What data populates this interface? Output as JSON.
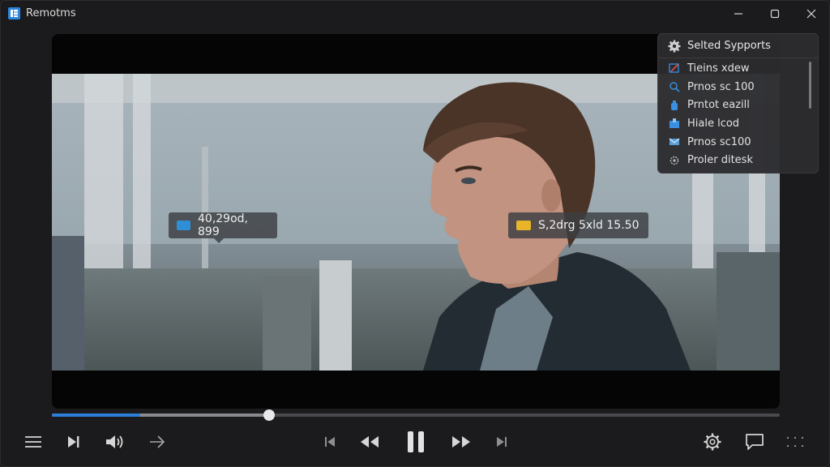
{
  "window": {
    "title": "Remotms"
  },
  "overlays": {
    "left_badge": "40,29od, 899",
    "right_badge": "S,2drg 5xld 15.50"
  },
  "panel": {
    "header": "Selted Sypports",
    "items": [
      {
        "label": "Tieins xdew",
        "icon": "pen-icon"
      },
      {
        "label": "Prnos sc 100",
        "icon": "search-icon"
      },
      {
        "label": "Prntot eazill",
        "icon": "bottle-icon"
      },
      {
        "label": "Hiale lcod",
        "icon": "upload-box-icon"
      },
      {
        "label": "Prnos sc100",
        "icon": "mail-icon"
      },
      {
        "label": "Proler ditesk",
        "icon": "gear-outline-icon"
      }
    ]
  },
  "playback": {
    "progress": 0.298,
    "buffered": 0.121
  },
  "colors": {
    "accent": "#2b7fd8",
    "badge_left_icon": "#2f8fd6",
    "badge_right_icon": "#e8b42a"
  }
}
